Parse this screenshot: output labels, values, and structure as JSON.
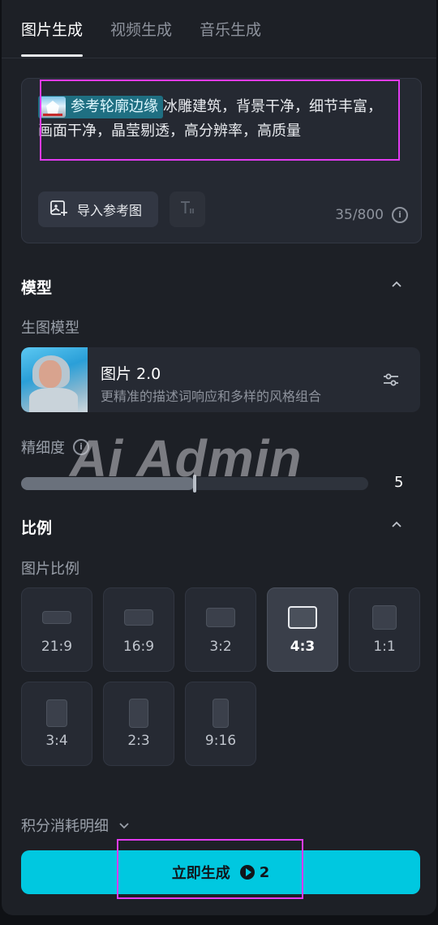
{
  "tabs": [
    {
      "label": "图片生成",
      "active": true
    },
    {
      "label": "视频生成",
      "active": false
    },
    {
      "label": "音乐生成",
      "active": false
    }
  ],
  "prompt": {
    "reference_chip_label": "参考轮廓边缘",
    "text": "冰雕建筑，背景干净，细节丰富，画面干净，晶莹剔透，高分辨率，高质量",
    "import_button_label": "导入参考图",
    "char_count": "35/800"
  },
  "model_section": {
    "title": "模型",
    "sub_label": "生图模型",
    "model_name": "图片 2.0",
    "model_desc": "更精准的描述词响应和多样的风格组合"
  },
  "detail": {
    "label": "精细度",
    "value": "5",
    "fill_fraction": 0.5
  },
  "watermark": "Ai Admin",
  "ratio_section": {
    "title": "比例",
    "sub_label": "图片比例",
    "options": [
      "21:9",
      "16:9",
      "3:2",
      "4:3",
      "1:1",
      "3:4",
      "2:3",
      "9:16"
    ],
    "selected": "4:3"
  },
  "credits_label": "积分消耗明细",
  "generate": {
    "label": "立即生成",
    "cost": "2"
  },
  "colors": {
    "accent": "#00c8e0",
    "annotation": "#e23bf0",
    "chip": "#1f6f82"
  }
}
